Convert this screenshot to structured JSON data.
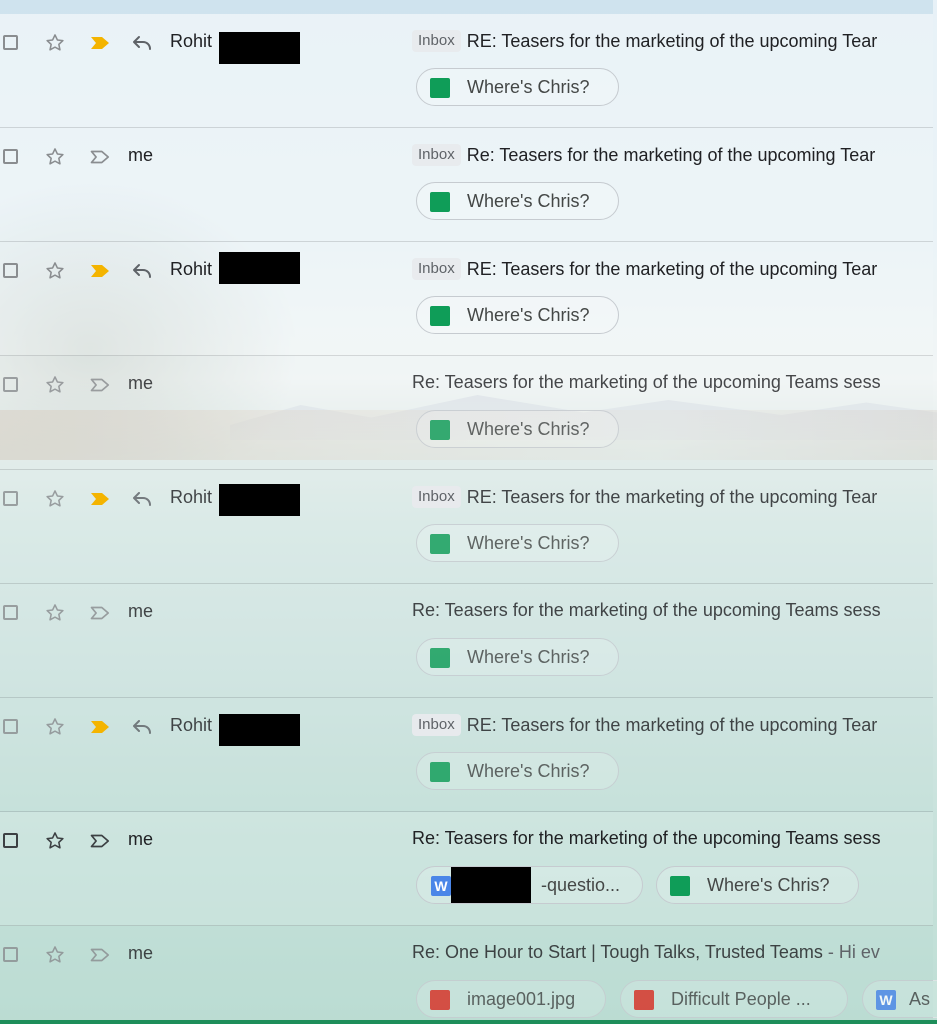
{
  "colors": {
    "important_marker": "#f4b400",
    "sheets_icon": "#0f9d58",
    "image_icon": "#d93025",
    "word_icon": "#4a86e8"
  },
  "rows": [
    {
      "sender": "Rohit",
      "badge": "Inbox",
      "subject": "RE: Teasers for the marketing of the upcoming Tear",
      "attachment": "Where's Chris?"
    },
    {
      "sender": "me",
      "badge": "Inbox",
      "subject": "Re: Teasers for the marketing of the upcoming Tear",
      "attachment": "Where's Chris?"
    },
    {
      "sender": "Rohit",
      "badge": "Inbox",
      "subject": "RE: Teasers for the marketing of the upcoming Tear",
      "attachment": "Where's Chris?"
    },
    {
      "sender": "me",
      "subject": "Re: Teasers for the marketing of the upcoming Teams sess",
      "attachment": "Where's Chris?"
    },
    {
      "sender": "Rohit",
      "badge": "Inbox",
      "subject": "RE: Teasers for the marketing of the upcoming Tear",
      "attachment": "Where's Chris?"
    },
    {
      "sender": "me",
      "subject": "Re: Teasers for the marketing of the upcoming Teams sess",
      "attachment": "Where's Chris?"
    },
    {
      "sender": "Rohit",
      "badge": "Inbox",
      "subject": "RE: Teasers for the marketing of the upcoming Tear",
      "attachment": "Where's Chris?"
    },
    {
      "sender": "me",
      "subject": "Re: Teasers for the marketing of the upcoming Teams sess",
      "attachments": [
        "W",
        "-questio...",
        "Where's Chris?"
      ]
    },
    {
      "sender": "me",
      "subject": "Re: One Hour to Start | Tough Talks, Trusted Teams",
      "snippet": " - Hi ev",
      "attachments": [
        "image001.jpg",
        "Difficult People ...",
        "W",
        "As"
      ]
    }
  ],
  "icons": [
    "checkbox-icon",
    "star-icon",
    "important-marker-icon",
    "reply-icon",
    "sheets-icon",
    "image-icon",
    "word-icon"
  ]
}
